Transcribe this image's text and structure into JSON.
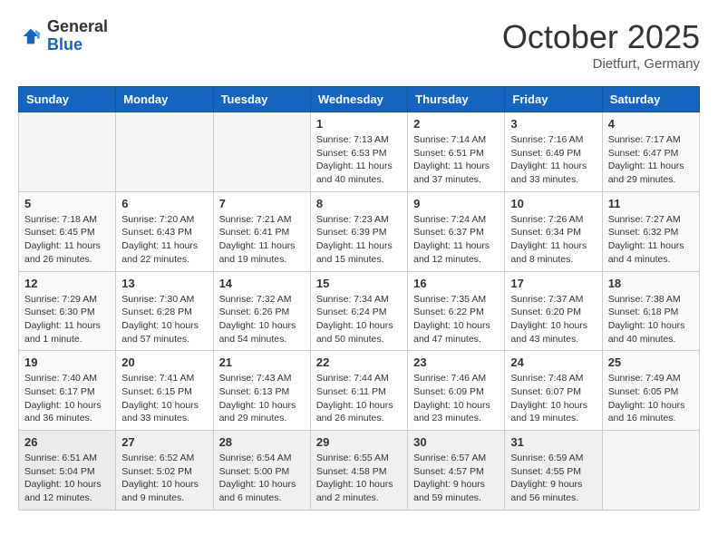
{
  "header": {
    "logo_general": "General",
    "logo_blue": "Blue",
    "month_title": "October 2025",
    "location": "Dietfurt, Germany"
  },
  "weekdays": [
    "Sunday",
    "Monday",
    "Tuesday",
    "Wednesday",
    "Thursday",
    "Friday",
    "Saturday"
  ],
  "weeks": [
    [
      {
        "day": "",
        "content": ""
      },
      {
        "day": "",
        "content": ""
      },
      {
        "day": "",
        "content": ""
      },
      {
        "day": "1",
        "content": "Sunrise: 7:13 AM\nSunset: 6:53 PM\nDaylight: 11 hours\nand 40 minutes."
      },
      {
        "day": "2",
        "content": "Sunrise: 7:14 AM\nSunset: 6:51 PM\nDaylight: 11 hours\nand 37 minutes."
      },
      {
        "day": "3",
        "content": "Sunrise: 7:16 AM\nSunset: 6:49 PM\nDaylight: 11 hours\nand 33 minutes."
      },
      {
        "day": "4",
        "content": "Sunrise: 7:17 AM\nSunset: 6:47 PM\nDaylight: 11 hours\nand 29 minutes."
      }
    ],
    [
      {
        "day": "5",
        "content": "Sunrise: 7:18 AM\nSunset: 6:45 PM\nDaylight: 11 hours\nand 26 minutes."
      },
      {
        "day": "6",
        "content": "Sunrise: 7:20 AM\nSunset: 6:43 PM\nDaylight: 11 hours\nand 22 minutes."
      },
      {
        "day": "7",
        "content": "Sunrise: 7:21 AM\nSunset: 6:41 PM\nDaylight: 11 hours\nand 19 minutes."
      },
      {
        "day": "8",
        "content": "Sunrise: 7:23 AM\nSunset: 6:39 PM\nDaylight: 11 hours\nand 15 minutes."
      },
      {
        "day": "9",
        "content": "Sunrise: 7:24 AM\nSunset: 6:37 PM\nDaylight: 11 hours\nand 12 minutes."
      },
      {
        "day": "10",
        "content": "Sunrise: 7:26 AM\nSunset: 6:34 PM\nDaylight: 11 hours\nand 8 minutes."
      },
      {
        "day": "11",
        "content": "Sunrise: 7:27 AM\nSunset: 6:32 PM\nDaylight: 11 hours\nand 4 minutes."
      }
    ],
    [
      {
        "day": "12",
        "content": "Sunrise: 7:29 AM\nSunset: 6:30 PM\nDaylight: 11 hours\nand 1 minute."
      },
      {
        "day": "13",
        "content": "Sunrise: 7:30 AM\nSunset: 6:28 PM\nDaylight: 10 hours\nand 57 minutes."
      },
      {
        "day": "14",
        "content": "Sunrise: 7:32 AM\nSunset: 6:26 PM\nDaylight: 10 hours\nand 54 minutes."
      },
      {
        "day": "15",
        "content": "Sunrise: 7:34 AM\nSunset: 6:24 PM\nDaylight: 10 hours\nand 50 minutes."
      },
      {
        "day": "16",
        "content": "Sunrise: 7:35 AM\nSunset: 6:22 PM\nDaylight: 10 hours\nand 47 minutes."
      },
      {
        "day": "17",
        "content": "Sunrise: 7:37 AM\nSunset: 6:20 PM\nDaylight: 10 hours\nand 43 minutes."
      },
      {
        "day": "18",
        "content": "Sunrise: 7:38 AM\nSunset: 6:18 PM\nDaylight: 10 hours\nand 40 minutes."
      }
    ],
    [
      {
        "day": "19",
        "content": "Sunrise: 7:40 AM\nSunset: 6:17 PM\nDaylight: 10 hours\nand 36 minutes."
      },
      {
        "day": "20",
        "content": "Sunrise: 7:41 AM\nSunset: 6:15 PM\nDaylight: 10 hours\nand 33 minutes."
      },
      {
        "day": "21",
        "content": "Sunrise: 7:43 AM\nSunset: 6:13 PM\nDaylight: 10 hours\nand 29 minutes."
      },
      {
        "day": "22",
        "content": "Sunrise: 7:44 AM\nSunset: 6:11 PM\nDaylight: 10 hours\nand 26 minutes."
      },
      {
        "day": "23",
        "content": "Sunrise: 7:46 AM\nSunset: 6:09 PM\nDaylight: 10 hours\nand 23 minutes."
      },
      {
        "day": "24",
        "content": "Sunrise: 7:48 AM\nSunset: 6:07 PM\nDaylight: 10 hours\nand 19 minutes."
      },
      {
        "day": "25",
        "content": "Sunrise: 7:49 AM\nSunset: 6:05 PM\nDaylight: 10 hours\nand 16 minutes."
      }
    ],
    [
      {
        "day": "26",
        "content": "Sunrise: 6:51 AM\nSunset: 5:04 PM\nDaylight: 10 hours\nand 12 minutes."
      },
      {
        "day": "27",
        "content": "Sunrise: 6:52 AM\nSunset: 5:02 PM\nDaylight: 10 hours\nand 9 minutes."
      },
      {
        "day": "28",
        "content": "Sunrise: 6:54 AM\nSunset: 5:00 PM\nDaylight: 10 hours\nand 6 minutes."
      },
      {
        "day": "29",
        "content": "Sunrise: 6:55 AM\nSunset: 4:58 PM\nDaylight: 10 hours\nand 2 minutes."
      },
      {
        "day": "30",
        "content": "Sunrise: 6:57 AM\nSunset: 4:57 PM\nDaylight: 9 hours\nand 59 minutes."
      },
      {
        "day": "31",
        "content": "Sunrise: 6:59 AM\nSunset: 4:55 PM\nDaylight: 9 hours\nand 56 minutes."
      },
      {
        "day": "",
        "content": ""
      }
    ]
  ]
}
